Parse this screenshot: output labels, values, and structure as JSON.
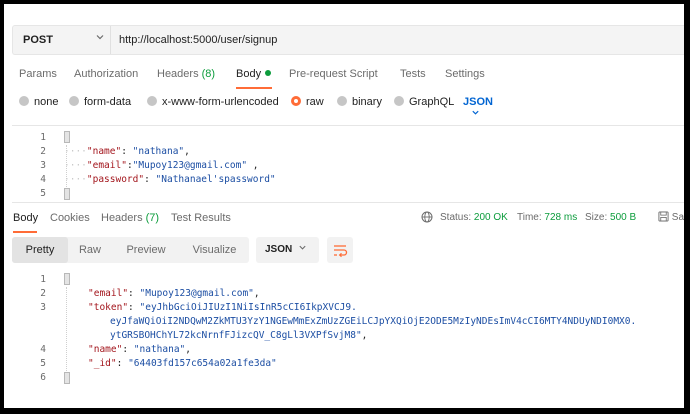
{
  "request": {
    "method": "POST",
    "url": "http://localhost:5000/user/signup"
  },
  "request_tabs": [
    {
      "label": "Params"
    },
    {
      "label": "Authorization"
    },
    {
      "label": "Headers",
      "count": "(8)"
    },
    {
      "label": "Body"
    },
    {
      "label": "Pre-request Script"
    },
    {
      "label": "Tests"
    },
    {
      "label": "Settings"
    }
  ],
  "body_types": [
    "none",
    "form-data",
    "x-www-form-urlencoded",
    "raw",
    "binary",
    "GraphQL"
  ],
  "body_type_selected": "raw",
  "body_format": "JSON",
  "request_body": {
    "line_numbers": [
      "1",
      "2",
      "3",
      "4",
      "5"
    ],
    "open_brace": "{",
    "close_brace": "}",
    "fields": [
      {
        "key": "\"name\"",
        "sep": ": ",
        "value": "\"nathana\"",
        "tail": ","
      },
      {
        "key": "\"email\"",
        "sep": ":",
        "value": "\"Mupoy123@gmail.com\"",
        "tail": " ,"
      },
      {
        "key": "\"password\"",
        "sep": ": ",
        "value": "\"Nathanael'spassword\"",
        "tail": ""
      }
    ]
  },
  "response_tabs": [
    {
      "label": "Body"
    },
    {
      "label": "Cookies"
    },
    {
      "label": "Headers",
      "count": "(7)"
    },
    {
      "label": "Test Results"
    }
  ],
  "response_meta": {
    "status_label": "Status:",
    "status_value": "200 OK",
    "time_label": "Time:",
    "time_value": "728 ms",
    "size_label": "Size:",
    "size_value": "500 B",
    "save_label": "Sa"
  },
  "view_modes": [
    "Pretty",
    "Raw",
    "Preview",
    "Visualize"
  ],
  "view_mode_selected": "Pretty",
  "response_format": "JSON",
  "response_body": {
    "line_numbers": [
      "1",
      "2",
      "3",
      "",
      "",
      "4",
      "5",
      "6"
    ],
    "open_brace": "{",
    "close_brace": "}",
    "email_key": "\"email\"",
    "email_value": "\"Mupoy123@gmail.com\"",
    "token_key": "\"token\"",
    "token_line_1": "\"eyJhbGciOiJIUzI1NiIsInR5cCI6IkpXVCJ9.",
    "token_line_2": "eyJfaWQiOiI2NDQwM2ZkMTU3YzY1NGEwMmExZmUzZGEiLCJpYXQiOjE2ODE5MzIyNDEsImV4cCI6MTY4NDUyNDI0MX0.",
    "token_line_3": "ytGRSBOHChYL72kcNrnfFJizcQV_C8gLl3VXPfSvjM8\"",
    "name_key": "\"name\"",
    "name_value": "\"nathana\"",
    "id_key": "\"_id\"",
    "id_value": "\"64403fd157c654a02a1fe3da\""
  },
  "colors": {
    "accent": "#ff6c37",
    "status_green": "#0c9c3c",
    "json_key": "#a3161d",
    "json_string": "#1c4ea3",
    "link_blue": "#0265d2"
  },
  "icons": [
    "chevron-down-icon",
    "globe-icon",
    "save-icon",
    "wrap-lines-icon"
  ]
}
